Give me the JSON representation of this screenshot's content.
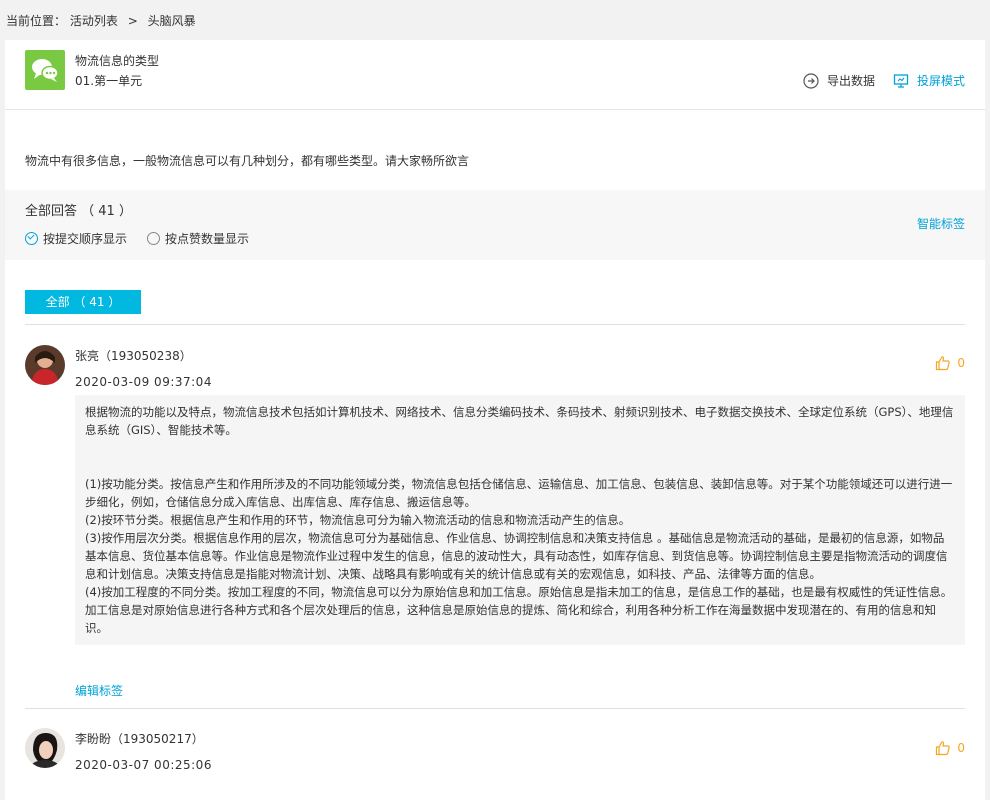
{
  "breadcrumb": {
    "prefix": "当前位置：",
    "item1": "活动列表",
    "sep": ">",
    "item2": "头脑风暴"
  },
  "header": {
    "title": "物流信息的类型",
    "unit": "01.第一单元",
    "export_label": "导出数据",
    "project_label": "投屏模式"
  },
  "question": "物流中有很多信息，一般物流信息可以有几种划分，都有哪些类型。请大家畅所欲言",
  "answers_bar": {
    "count_label": "全部回答 （ 41 ）",
    "sort_by_time": "按提交顺序显示",
    "sort_by_likes": "按点赞数量显示",
    "smart_tag": "智能标签"
  },
  "tab_all": "全部 （ 41 ）",
  "answers": [
    {
      "name": "张亮（193050238）",
      "time": "2020-03-09 09:37:04",
      "likes": "0",
      "para1": "根据物流的功能以及特点，物流信息技术包括如计算机技术、网络技术、信息分类编码技术、条码技术、射频识别技术、电子数据交换技术、全球定位系统（GPS）、地理信息系统（GIS）、智能技术等。",
      "para2": "(1)按功能分类。按信息产生和作用所涉及的不同功能领域分类，物流信息包括仓储信息、运输信息、加工信息、包装信息、装卸信息等。对于某个功能领域还可以进行进一步细化，例如，仓储信息分成入库信息、出库信息、库存信息、搬运信息等。",
      "para3": "(2)按环节分类。根据信息产生和作用的环节，物流信息可分为输入物流活动的信息和物流活动产生的信息。",
      "para4": "(3)按作用层次分类。根据信息作用的层次，物流信息可分为基础信息、作业信息、协调控制信息和决策支持信息 。基础信息是物流活动的基础，是最初的信息源，如物品基本信息、货位基本信息等。作业信息是物流作业过程中发生的信息，信息的波动性大，具有动态性，如库存信息、到货信息等。协调控制信息主要是指物流活动的调度信息和计划信息。决策支持信息是指能对物流计划、决策、战略具有影响或有关的统计信息或有关的宏观信息，如科技、产品、法律等方面的信息。",
      "para5": "(4)按加工程度的不同分类。按加工程度的不同，物流信息可以分为原始信息和加工信息。原始信息是指未加工的信息，是信息工作的基础，也是最有权威性的凭证性信息。加工信息是对原始信息进行各种方式和各个层次处理后的信息，这种信息是原始信息的提炼、简化和综合，利用各种分析工作在海量数据中发现潜在的、有用的信息和知识。",
      "edit_tag": "编辑标签"
    },
    {
      "name": "李盼盼（193050217）",
      "time": "2020-03-07 00:25:06",
      "likes": "0"
    }
  ],
  "colors": {
    "accent": "#00a2d6",
    "tab_bg": "#00b8e0",
    "logo_green": "#7ac943",
    "like_orange": "#f5a623"
  }
}
